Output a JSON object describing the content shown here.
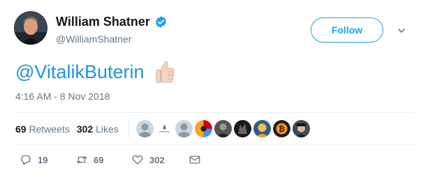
{
  "tweet": {
    "author_name": "William Shatner",
    "author_handle": "@WilliamShatner",
    "follow_label": "Follow",
    "text_mention": "@VitalikButerin",
    "emoji": "thumbs-up",
    "timestamp": "4:16 AM - 8 Nov 2018"
  },
  "stats": {
    "retweets_count": "69",
    "retweets_label": "Retweets",
    "likes_count": "302",
    "likes_label": "Likes"
  },
  "likers": [
    {
      "icon": "default-avatar"
    },
    {
      "icon": "small-logo-avatar"
    },
    {
      "icon": "default-avatar"
    },
    {
      "icon": "colorful-circle-avatar"
    },
    {
      "icon": "dark-portrait-avatar"
    },
    {
      "icon": "dark-creature-avatar"
    },
    {
      "icon": "yellow-portrait-avatar"
    },
    {
      "icon": "bitcoin-avatar"
    },
    {
      "icon": "hat-portrait-avatar"
    }
  ],
  "actions": {
    "replies": "19",
    "retweets": "69",
    "likes": "302"
  },
  "colors": {
    "accent": "#1da1f2",
    "mention": "#1b95e0",
    "muted": "#657786",
    "divider": "#e6ecf0"
  }
}
